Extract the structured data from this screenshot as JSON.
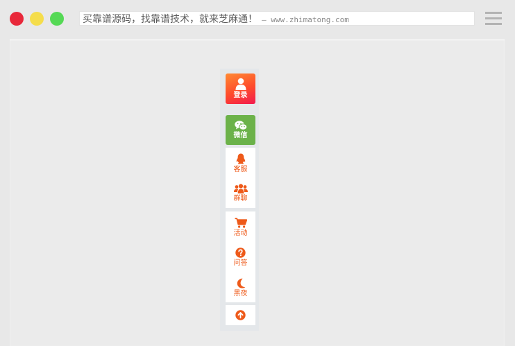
{
  "window": {
    "address_main": "买靠谱源码，找靠谱技术，就来芝麻通！",
    "address_sub": "– www.zhimatong.com"
  },
  "sidebar": {
    "login_label": "登录",
    "wechat_label": "微信",
    "service_label": "客服",
    "group_label": "群聊",
    "activity_label": "活动",
    "qa_label": "问答",
    "night_label": "黑夜"
  },
  "icons": {
    "login": "user-icon",
    "wechat": "wechat-icon",
    "service": "qq-penguin-icon",
    "group": "users-icon",
    "activity": "cart-icon",
    "qa": "question-circle-icon",
    "night": "moon-icon",
    "top": "arrow-up-circle-icon"
  },
  "colors": {
    "accent_orange": "#ee5a1a",
    "wechat_green": "#6bb24a",
    "login_gradient_start": "#ff8a33",
    "login_gradient_end": "#f21a50"
  }
}
